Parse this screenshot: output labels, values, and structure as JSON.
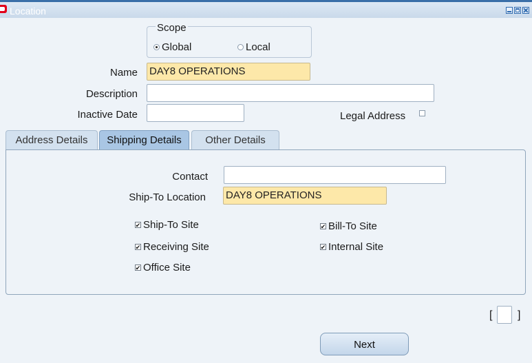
{
  "window": {
    "title": "Location"
  },
  "scope": {
    "label": "Scope",
    "global_label": "Global",
    "local_label": "Local",
    "selected": "Global"
  },
  "form": {
    "name_label": "Name",
    "name_value": "DAY8 OPERATIONS",
    "description_label": "Description",
    "description_value": "",
    "inactive_date_label": "Inactive Date",
    "inactive_date_value": "",
    "legal_address_label": "Legal Address",
    "legal_address_checked": false
  },
  "tabs": [
    {
      "label": "Address Details",
      "active": false
    },
    {
      "label": "Shipping Details",
      "active": true
    },
    {
      "label": "Other Details",
      "active": false
    }
  ],
  "shipping": {
    "contact_label": "Contact",
    "contact_value": "",
    "ship_to_location_label": "Ship-To Location",
    "ship_to_location_value": "DAY8 OPERATIONS",
    "checks": {
      "ship_to_site": {
        "label": "Ship-To Site",
        "checked": true
      },
      "bill_to_site": {
        "label": "Bill-To Site",
        "checked": true
      },
      "receiving_site": {
        "label": "Receiving Site",
        "checked": true
      },
      "internal_site": {
        "label": "Internal Site",
        "checked": true
      },
      "office_site": {
        "label": "Office Site",
        "checked": true
      }
    }
  },
  "footer": {
    "bracket_open": "[",
    "bracket_close": "]",
    "next_label": "Next"
  },
  "colors": {
    "title_bar_border": "#3a6fa8",
    "required_field": "#fde8a9",
    "active_tab": "#a9c6e4",
    "background": "#eef3f8"
  }
}
